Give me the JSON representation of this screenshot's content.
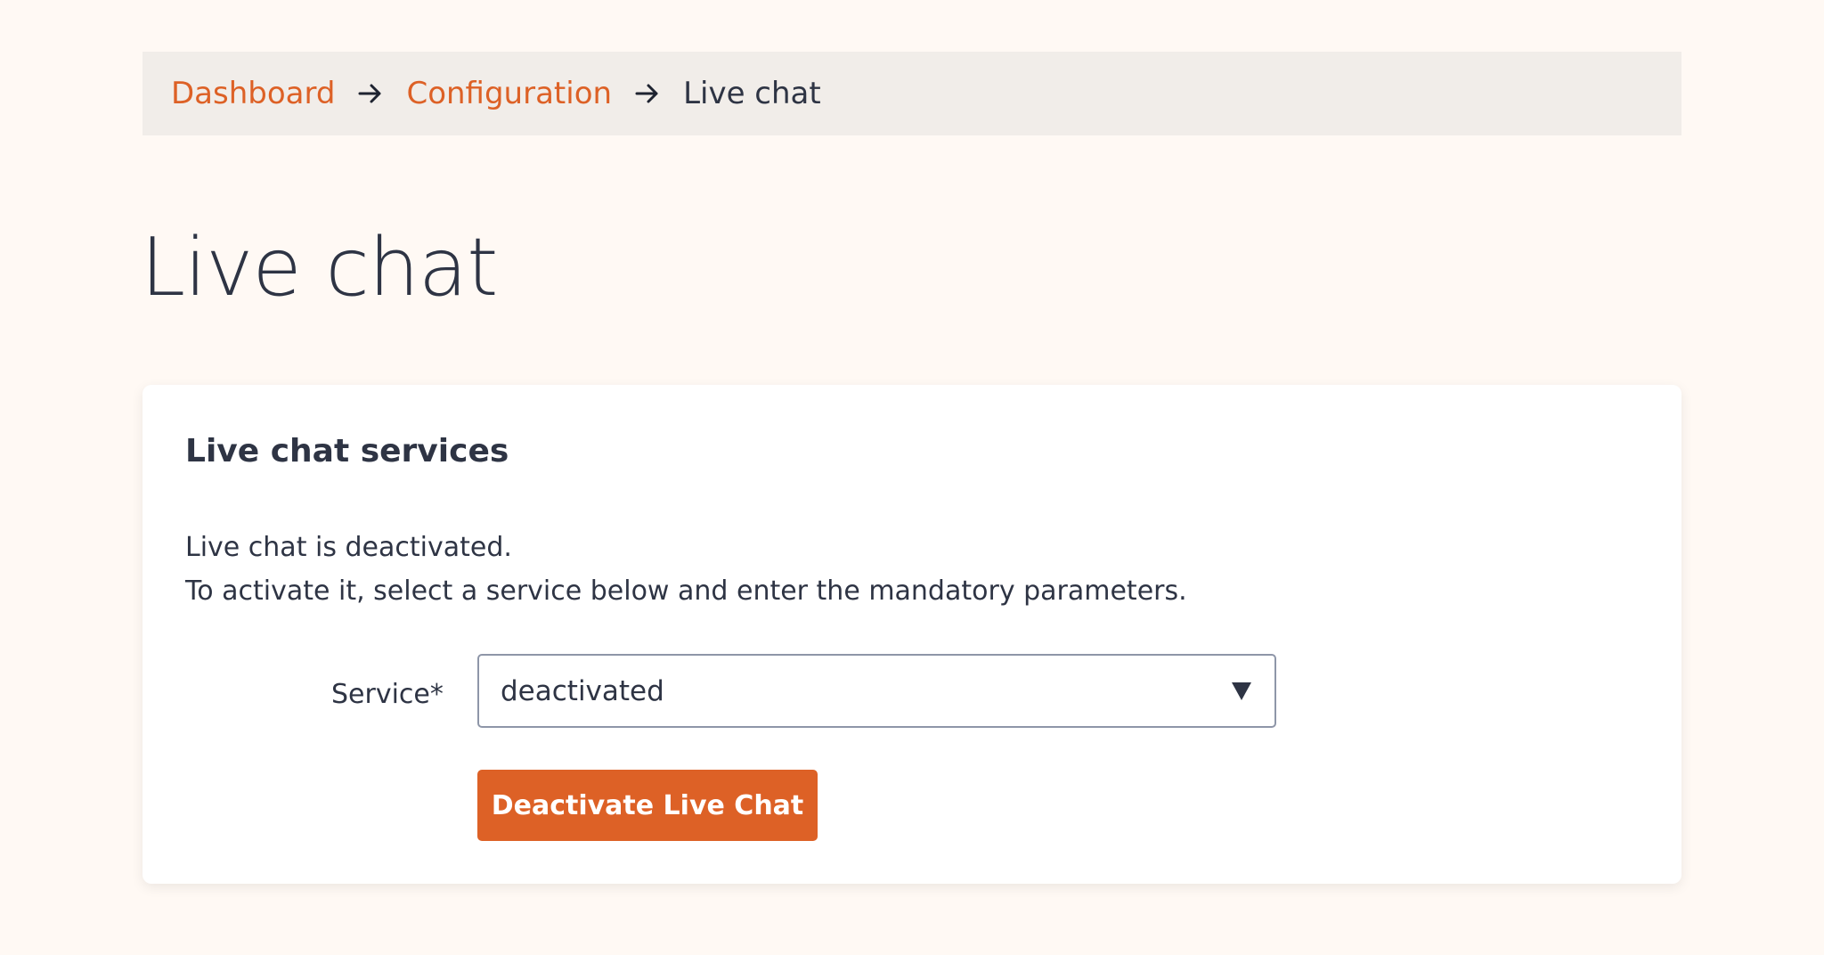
{
  "breadcrumb": {
    "items": [
      {
        "label": "Dashboard",
        "link": true
      },
      {
        "label": "Configuration",
        "link": true
      },
      {
        "label": "Live chat",
        "link": false
      }
    ],
    "separator_icon": "arrow-right-icon"
  },
  "page": {
    "title": "Live chat"
  },
  "card": {
    "title": "Live chat services",
    "description_line1": "Live chat is deactivated.",
    "description_line2": "To activate it, select a service below and enter the mandatory parameters.",
    "service_label": "Service*",
    "service_value": "deactivated",
    "button_label": "Deactivate Live Chat"
  },
  "colors": {
    "accent": "#dd6126",
    "text": "#2e3444",
    "background": "#fff9f4",
    "breadcrumb_bg": "#f1ede9"
  }
}
